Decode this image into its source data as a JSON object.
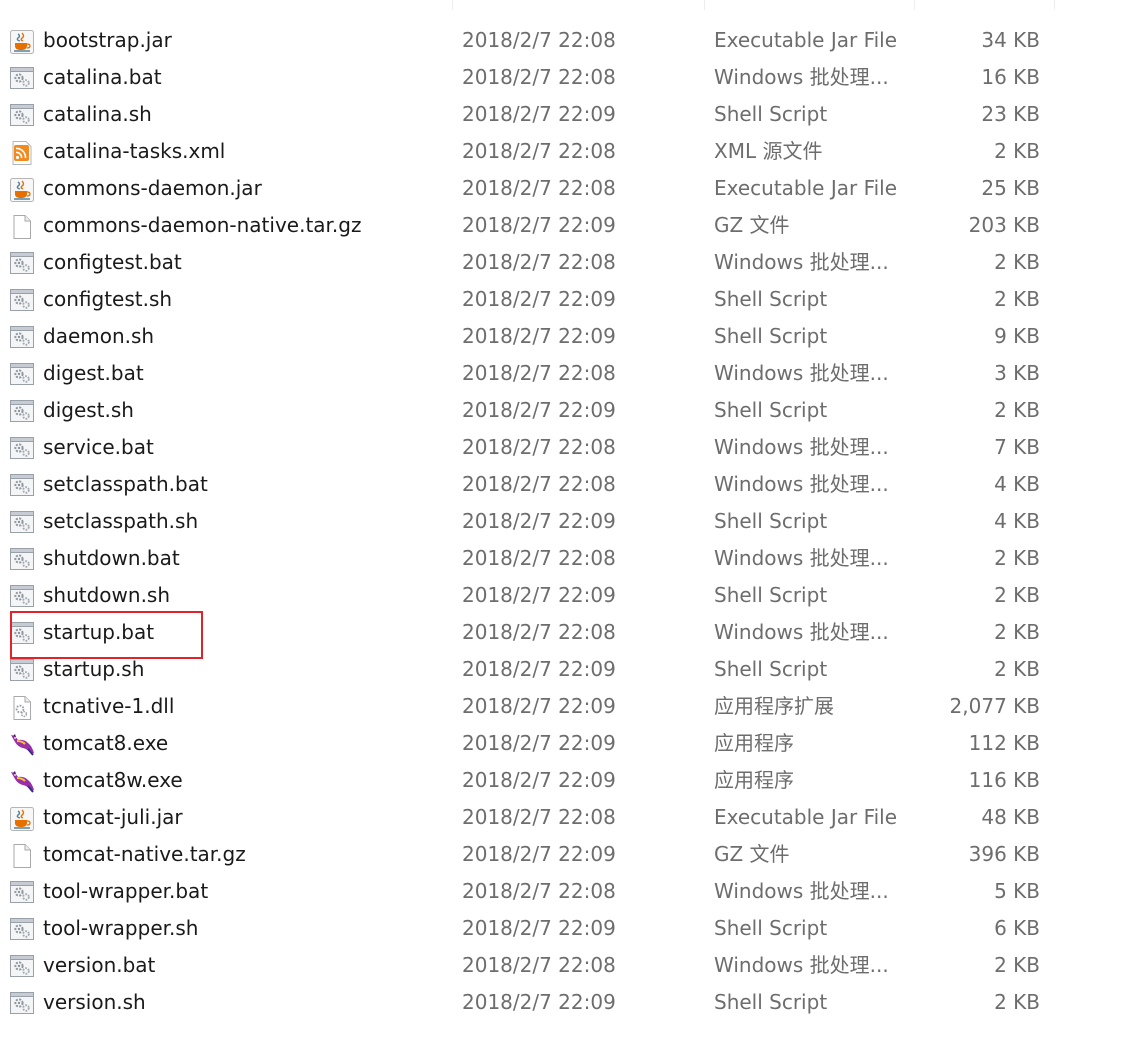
{
  "files": [
    {
      "name": "bootstrap.jar",
      "modified": "2018/2/7 22:08",
      "type": "Executable Jar File",
      "size": "34 KB",
      "icon": "jar-file-icon"
    },
    {
      "name": "catalina.bat",
      "modified": "2018/2/7 22:08",
      "type": "Windows 批处理...",
      "size": "16 KB",
      "icon": "batch-file-icon"
    },
    {
      "name": "catalina.sh",
      "modified": "2018/2/7 22:09",
      "type": "Shell Script",
      "size": "23 KB",
      "icon": "script-file-icon"
    },
    {
      "name": "catalina-tasks.xml",
      "modified": "2018/2/7 22:08",
      "type": "XML 源文件",
      "size": "2 KB",
      "icon": "xml-rss-file-icon"
    },
    {
      "name": "commons-daemon.jar",
      "modified": "2018/2/7 22:08",
      "type": "Executable Jar File",
      "size": "25 KB",
      "icon": "jar-file-icon"
    },
    {
      "name": "commons-daemon-native.tar.gz",
      "modified": "2018/2/7 22:09",
      "type": "GZ 文件",
      "size": "203 KB",
      "icon": "blank-file-icon"
    },
    {
      "name": "configtest.bat",
      "modified": "2018/2/7 22:08",
      "type": "Windows 批处理...",
      "size": "2 KB",
      "icon": "batch-file-icon"
    },
    {
      "name": "configtest.sh",
      "modified": "2018/2/7 22:09",
      "type": "Shell Script",
      "size": "2 KB",
      "icon": "script-file-icon"
    },
    {
      "name": "daemon.sh",
      "modified": "2018/2/7 22:09",
      "type": "Shell Script",
      "size": "9 KB",
      "icon": "script-file-icon"
    },
    {
      "name": "digest.bat",
      "modified": "2018/2/7 22:08",
      "type": "Windows 批处理...",
      "size": "3 KB",
      "icon": "batch-file-icon"
    },
    {
      "name": "digest.sh",
      "modified": "2018/2/7 22:09",
      "type": "Shell Script",
      "size": "2 KB",
      "icon": "script-file-icon"
    },
    {
      "name": "service.bat",
      "modified": "2018/2/7 22:08",
      "type": "Windows 批处理...",
      "size": "7 KB",
      "icon": "batch-file-icon"
    },
    {
      "name": "setclasspath.bat",
      "modified": "2018/2/7 22:08",
      "type": "Windows 批处理...",
      "size": "4 KB",
      "icon": "batch-file-icon"
    },
    {
      "name": "setclasspath.sh",
      "modified": "2018/2/7 22:09",
      "type": "Shell Script",
      "size": "4 KB",
      "icon": "script-file-icon"
    },
    {
      "name": "shutdown.bat",
      "modified": "2018/2/7 22:08",
      "type": "Windows 批处理...",
      "size": "2 KB",
      "icon": "batch-file-icon"
    },
    {
      "name": "shutdown.sh",
      "modified": "2018/2/7 22:09",
      "type": "Shell Script",
      "size": "2 KB",
      "icon": "script-file-icon"
    },
    {
      "name": "startup.bat",
      "modified": "2018/2/7 22:08",
      "type": "Windows 批处理...",
      "size": "2 KB",
      "icon": "batch-file-icon",
      "highlighted": true
    },
    {
      "name": "startup.sh",
      "modified": "2018/2/7 22:09",
      "type": "Shell Script",
      "size": "2 KB",
      "icon": "script-file-icon"
    },
    {
      "name": "tcnative-1.dll",
      "modified": "2018/2/7 22:09",
      "type": "应用程序扩展",
      "size": "2,077 KB",
      "icon": "dll-file-icon"
    },
    {
      "name": "tomcat8.exe",
      "modified": "2018/2/7 22:09",
      "type": "应用程序",
      "size": "112 KB",
      "icon": "tomcat-exe-icon"
    },
    {
      "name": "tomcat8w.exe",
      "modified": "2018/2/7 22:09",
      "type": "应用程序",
      "size": "116 KB",
      "icon": "tomcat-exe-icon"
    },
    {
      "name": "tomcat-juli.jar",
      "modified": "2018/2/7 22:08",
      "type": "Executable Jar File",
      "size": "48 KB",
      "icon": "jar-file-icon"
    },
    {
      "name": "tomcat-native.tar.gz",
      "modified": "2018/2/7 22:09",
      "type": "GZ 文件",
      "size": "396 KB",
      "icon": "blank-file-icon"
    },
    {
      "name": "tool-wrapper.bat",
      "modified": "2018/2/7 22:08",
      "type": "Windows 批处理...",
      "size": "5 KB",
      "icon": "batch-file-icon"
    },
    {
      "name": "tool-wrapper.sh",
      "modified": "2018/2/7 22:09",
      "type": "Shell Script",
      "size": "6 KB",
      "icon": "script-file-icon"
    },
    {
      "name": "version.bat",
      "modified": "2018/2/7 22:08",
      "type": "Windows 批处理...",
      "size": "2 KB",
      "icon": "batch-file-icon"
    },
    {
      "name": "version.sh",
      "modified": "2018/2/7 22:09",
      "type": "Shell Script",
      "size": "2 KB",
      "icon": "script-file-icon"
    }
  ],
  "colors": {
    "highlight_border": "#e3232b",
    "name_text": "#1a1a1a",
    "detail_text": "#6d6d6d",
    "java_cup": "#e76f00",
    "java_steam": "#5382a1",
    "rss_orange": "#f28a1e",
    "tomcat_purple": "#9b2fa8"
  }
}
